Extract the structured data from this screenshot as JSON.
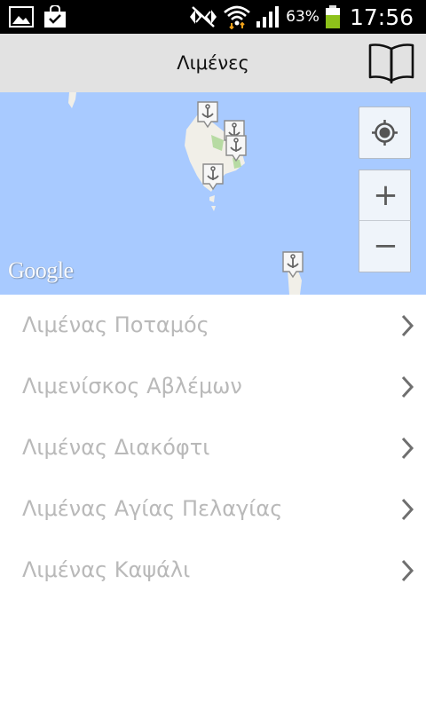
{
  "status_bar": {
    "battery_percent": "63%",
    "time": "17:56",
    "icons": [
      "gallery-icon",
      "shopping-bag-icon",
      "no-signal-icon",
      "wifi-icon",
      "cell-signal-icon",
      "battery-icon"
    ]
  },
  "app_bar": {
    "title": "Λιμένες",
    "action_icon": "book-icon"
  },
  "map": {
    "logo": "Google",
    "markers": [
      "anchor-icon",
      "anchor-icon",
      "anchor-icon",
      "anchor-icon",
      "anchor-icon"
    ],
    "controls": {
      "locate_icon": "my-location-icon",
      "zoom_in": "+",
      "zoom_out": "−"
    },
    "colors": {
      "water": "#a8caff",
      "land": "#f1efe8",
      "park": "#b7dba3"
    }
  },
  "ports": [
    {
      "label": "Λιμένας Ποταμός"
    },
    {
      "label": "Λιμενίσκος Αβλέμων"
    },
    {
      "label": "Λιμένας Διακόφτι"
    },
    {
      "label": "Λιμένας Αγίας Πελαγίας"
    },
    {
      "label": "Λιμένας Καψάλι"
    }
  ]
}
